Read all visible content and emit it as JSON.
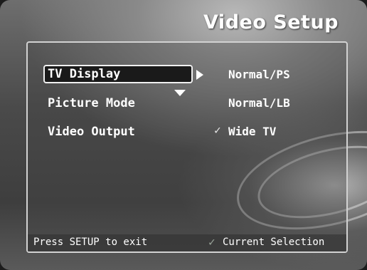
{
  "header": {
    "title": "Video Setup"
  },
  "menu": {
    "items": [
      {
        "label": "TV Display"
      },
      {
        "label": "Picture Mode"
      },
      {
        "label": "Video Output"
      }
    ]
  },
  "options": {
    "items": [
      {
        "label": "Normal/PS"
      },
      {
        "label": "Normal/LB"
      },
      {
        "label": "Wide TV",
        "current": true
      }
    ]
  },
  "footer": {
    "hint": "Press SETUP to exit",
    "legend": "Current Selection"
  },
  "icons": {
    "check": "✓",
    "right_arrow": "right-arrow-icon",
    "down_arrow": "down-arrow-icon"
  },
  "colors": {
    "text": "#ffffff",
    "highlight_border": "#f0f0f0"
  }
}
